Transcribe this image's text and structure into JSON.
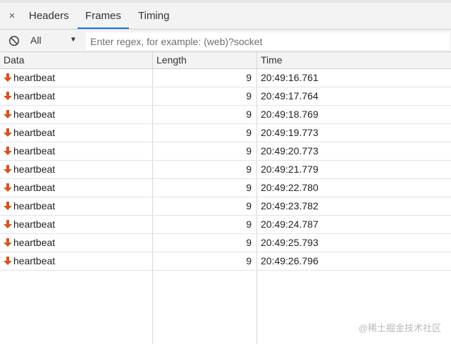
{
  "tabs": {
    "close_label": "×",
    "items": [
      {
        "label": "Headers",
        "active": false
      },
      {
        "label": "Frames",
        "active": true
      },
      {
        "label": "Timing",
        "active": false
      }
    ]
  },
  "filter": {
    "block_icon": "block-icon",
    "select_value": "All",
    "caret": "▼",
    "placeholder": "Enter regex, for example: (web)?socket"
  },
  "table": {
    "columns": [
      "Data",
      "Length",
      "Time"
    ],
    "direction_icon": "arrow-down-icon",
    "arrow_color": "#d9531e",
    "rows": [
      {
        "data": "heartbeat",
        "length": "9",
        "time": "20:49:16.761"
      },
      {
        "data": "heartbeat",
        "length": "9",
        "time": "20:49:17.764"
      },
      {
        "data": "heartbeat",
        "length": "9",
        "time": "20:49:18.769"
      },
      {
        "data": "heartbeat",
        "length": "9",
        "time": "20:49:19.773"
      },
      {
        "data": "heartbeat",
        "length": "9",
        "time": "20:49:20.773"
      },
      {
        "data": "heartbeat",
        "length": "9",
        "time": "20:49:21.779"
      },
      {
        "data": "heartbeat",
        "length": "9",
        "time": "20:49:22.780"
      },
      {
        "data": "heartbeat",
        "length": "9",
        "time": "20:49:23.782"
      },
      {
        "data": "heartbeat",
        "length": "9",
        "time": "20:49:24.787"
      },
      {
        "data": "heartbeat",
        "length": "9",
        "time": "20:49:25.793"
      },
      {
        "data": "heartbeat",
        "length": "9",
        "time": "20:49:26.796"
      }
    ]
  },
  "watermark": "@稀土掘金技术社区",
  "colors": {
    "tab_active_underline": "#1a73e8",
    "toolbar_bg": "#f3f3f3",
    "grid_line": "#d6d6d6"
  }
}
